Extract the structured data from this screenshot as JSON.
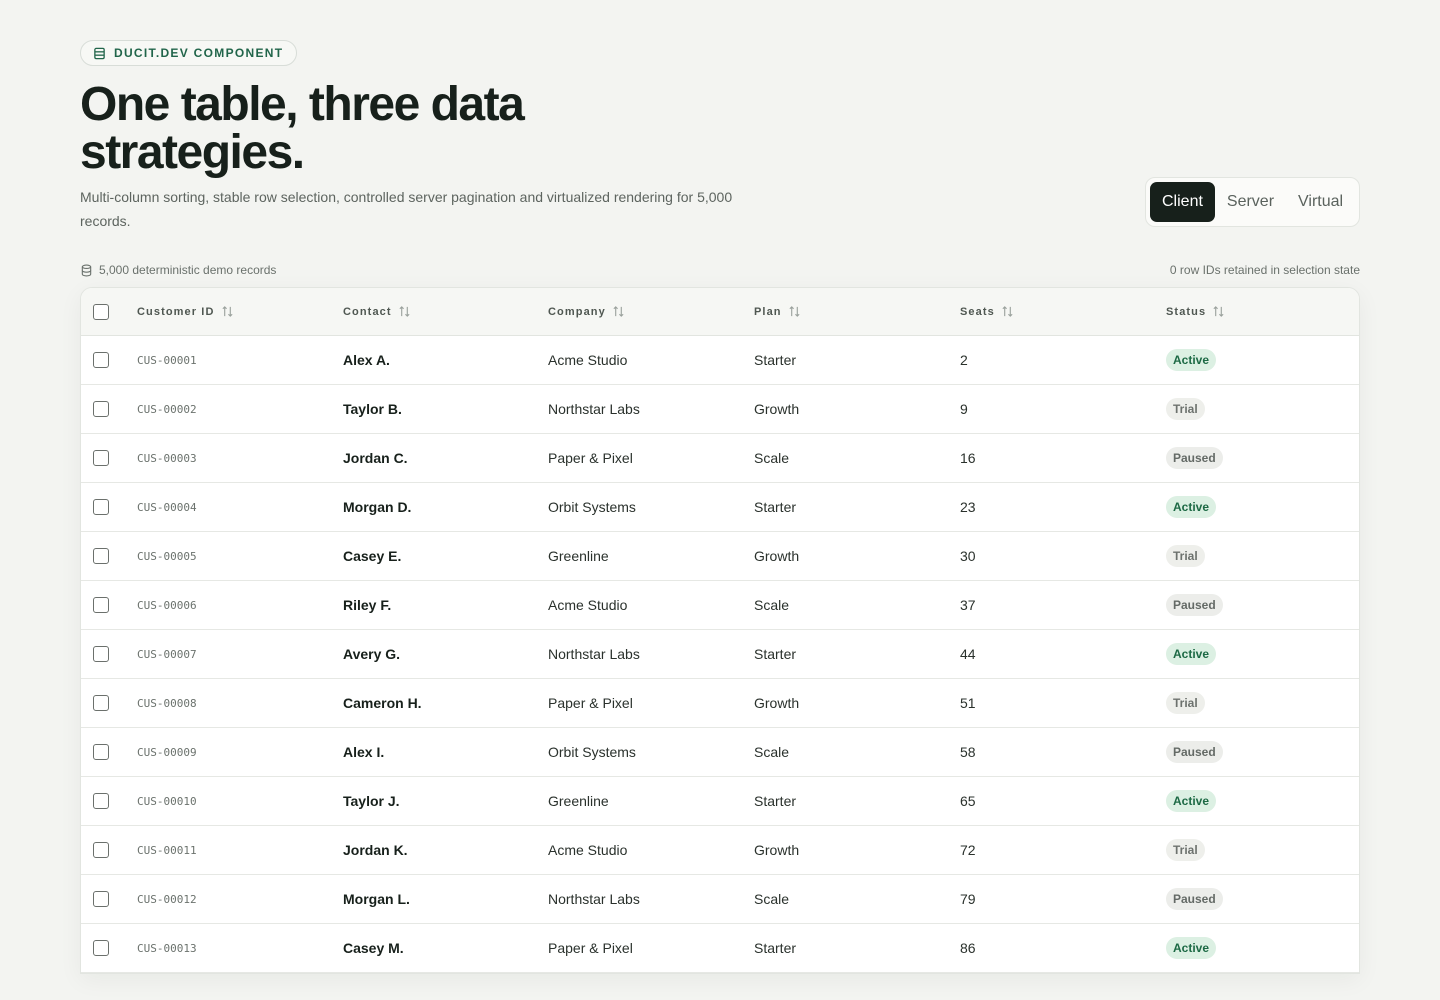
{
  "header": {
    "badge_label": "DUCIT.DEV COMPONENT",
    "title": "One table, three data strategies.",
    "subtitle": "Multi-column sorting, stable row selection, controlled server pagination and virtualized rendering for 5,000 records."
  },
  "modes": {
    "options": [
      "Client",
      "Server",
      "Virtual"
    ],
    "selected": "Client"
  },
  "meta": {
    "records_label": "5,000 deterministic demo records",
    "selection_label": "0 row IDs retained in selection state"
  },
  "table": {
    "columns": [
      "Customer ID",
      "Contact",
      "Company",
      "Plan",
      "Seats",
      "Status"
    ],
    "rows": [
      {
        "id": "CUS-00001",
        "contact": "Alex A.",
        "company": "Acme Studio",
        "plan": "Starter",
        "seats": "2",
        "status": "Active"
      },
      {
        "id": "CUS-00002",
        "contact": "Taylor B.",
        "company": "Northstar Labs",
        "plan": "Growth",
        "seats": "9",
        "status": "Trial"
      },
      {
        "id": "CUS-00003",
        "contact": "Jordan C.",
        "company": "Paper & Pixel",
        "plan": "Scale",
        "seats": "16",
        "status": "Paused"
      },
      {
        "id": "CUS-00004",
        "contact": "Morgan D.",
        "company": "Orbit Systems",
        "plan": "Starter",
        "seats": "23",
        "status": "Active"
      },
      {
        "id": "CUS-00005",
        "contact": "Casey E.",
        "company": "Greenline",
        "plan": "Growth",
        "seats": "30",
        "status": "Trial"
      },
      {
        "id": "CUS-00006",
        "contact": "Riley F.",
        "company": "Acme Studio",
        "plan": "Scale",
        "seats": "37",
        "status": "Paused"
      },
      {
        "id": "CUS-00007",
        "contact": "Avery G.",
        "company": "Northstar Labs",
        "plan": "Starter",
        "seats": "44",
        "status": "Active"
      },
      {
        "id": "CUS-00008",
        "contact": "Cameron H.",
        "company": "Paper & Pixel",
        "plan": "Growth",
        "seats": "51",
        "status": "Trial"
      },
      {
        "id": "CUS-00009",
        "contact": "Alex I.",
        "company": "Orbit Systems",
        "plan": "Scale",
        "seats": "58",
        "status": "Paused"
      },
      {
        "id": "CUS-00010",
        "contact": "Taylor J.",
        "company": "Greenline",
        "plan": "Starter",
        "seats": "65",
        "status": "Active"
      },
      {
        "id": "CUS-00011",
        "contact": "Jordan K.",
        "company": "Acme Studio",
        "plan": "Growth",
        "seats": "72",
        "status": "Trial"
      },
      {
        "id": "CUS-00012",
        "contact": "Morgan L.",
        "company": "Northstar Labs",
        "plan": "Scale",
        "seats": "79",
        "status": "Paused"
      },
      {
        "id": "CUS-00013",
        "contact": "Casey M.",
        "company": "Paper & Pixel",
        "plan": "Starter",
        "seats": "86",
        "status": "Active"
      }
    ]
  }
}
